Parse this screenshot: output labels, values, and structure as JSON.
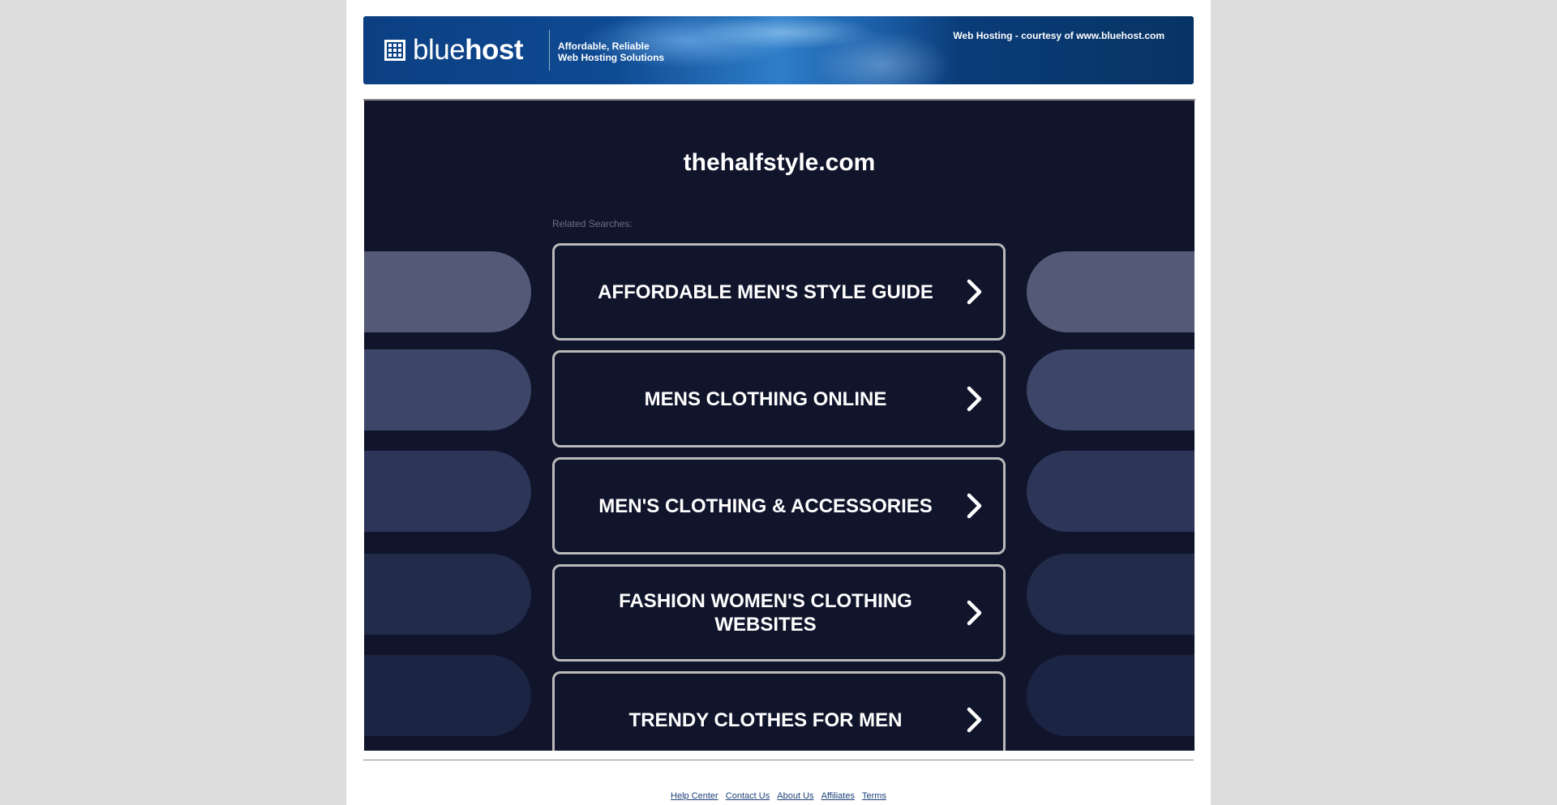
{
  "header": {
    "logo": {
      "brand_light": "blue",
      "brand_bold": "host"
    },
    "tagline_line1": "Affordable, Reliable",
    "tagline_line2": "Web Hosting Solutions",
    "courtesy": "Web Hosting - courtesy of www.bluehost.com"
  },
  "main": {
    "domain": "thehalfstyle.com",
    "related_label": "Related Searches:",
    "results": [
      {
        "line1": "AFFORDABLE MEN'S STYLE GUIDE",
        "line2": ""
      },
      {
        "line1": "MENS CLOTHING ONLINE",
        "line2": ""
      },
      {
        "line1": "MEN'S CLOTHING & ACCESSORIES",
        "line2": ""
      },
      {
        "line1": "FASHION WOMEN'S CLOTHING",
        "line2": "WEBSITES"
      },
      {
        "line1": "TRENDY CLOTHES FOR MEN",
        "line2": ""
      }
    ],
    "arrow_icon": "chevron-right-icon"
  },
  "footer": {
    "links": [
      "Help Center",
      "Contact Us",
      "About Us",
      "Affiliates",
      "Terms"
    ]
  },
  "colors": {
    "frame_background": "#11152c",
    "pill_colors": [
      "#525a78",
      "#3d4668",
      "#2d3658",
      "#222b4a",
      "#1c2443"
    ],
    "button_border": "#b9b9b9",
    "banner_blue": "#0c3f82"
  }
}
